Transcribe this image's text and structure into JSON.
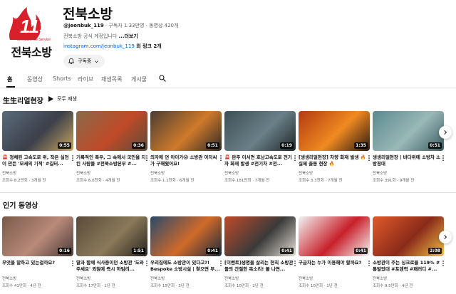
{
  "channel": {
    "name": "전북소방",
    "logo_text": "전북소방",
    "logo_badge": "119",
    "logo_sub": "Jeonbuk Fire Service",
    "handle": "@jeonbuk_119",
    "stats": " · 구독자 1.33만명 · 동영상 420개",
    "description": "전북소방 공식 계정입니다 ",
    "description_more": "...더보기",
    "link": "instagram.com/jeonbuk_119",
    "link_more": " 외 링크 2개",
    "subscribe_label": "구독중"
  },
  "tabs": [
    {
      "label": "홈"
    },
    {
      "label": "동영상"
    },
    {
      "label": "Shorts"
    },
    {
      "label": "라이브"
    },
    {
      "label": "재생목록"
    },
    {
      "label": "게시물"
    }
  ],
  "sections": [
    {
      "title": "生生리얼현장",
      "play_all": "모두 재생",
      "videos": [
        {
          "title": "🚨 정체된 고속도로 위, 작은 실천이 만든 '모세의 기적' #길터...",
          "channel": "전북소방",
          "meta": "조회수 8.2만회 · 3개월 전",
          "duration": "0:55",
          "colors": [
            "#5a6b7a",
            "#3b3f4a",
            "#c8a560"
          ]
        },
        {
          "title": "기록적인 폭우, 그 속에서 국민을 지킨 사람들 #전북소방본부 #...",
          "channel": "전북소방",
          "meta": "조회수 6.6천회 · 4개월 전",
          "duration": "0:36",
          "colors": [
            "#8a6a4a",
            "#c04a28",
            "#5b4c3a"
          ]
        },
        {
          "title": "의자에 연 아이가😱 소방관 아저씨가 구해줬어요!",
          "channel": "전북소방",
          "meta": "조회수 1.1천회 · 6개월 전",
          "duration": "0:51",
          "colors": [
            "#4a3d33",
            "#d07a2a",
            "#2e2a26"
          ]
        },
        {
          "title": "🚨 완주 이서면 호남고속도로 전기차 화재 발생 #전기차 #전...",
          "channel": "전북소방",
          "meta": "조회수 181만회 · 7개월 전",
          "duration": "0:19",
          "colors": [
            "#3d4f55",
            "#6a8088",
            "#1e2628"
          ]
        },
        {
          "title": "[생생리얼현장] 차량 화재 발생 🔥 실제 출동 현장 🔥",
          "channel": "전북소방",
          "meta": "조회수 3.3천회 · 7개월 전",
          "duration": "1:35",
          "colors": [
            "#b23a12",
            "#f08a20",
            "#2a1a12"
          ]
        },
        {
          "title": "생생리얼현장 | 바다위에 소방차 소방정대",
          "channel": "전북소방",
          "meta": "조회수 391회 · 9개월 전",
          "duration": "0:51",
          "colors": [
            "#5a8a8e",
            "#9ab8b8",
            "#3a5a5e"
          ]
        }
      ]
    },
    {
      "title": "인기 동영상",
      "videos": [
        {
          "title": "무엇을 말하고 있는걸까요?",
          "channel": "전북소방",
          "meta": "조회수 41만회 · 4년 전",
          "duration": "0:16",
          "colors": [
            "#7a5a4a",
            "#b88a7a",
            "#4a3a36"
          ]
        },
        {
          "title": "딸과 함께 식사중이던 소방관 '도와주세요' 외침에 즉시 하임리...",
          "channel": "전북소방",
          "meta": "조회수 17만회 · 1년 전",
          "duration": "1:51",
          "colors": [
            "#5a4a3a",
            "#8a7a5a",
            "#2a2420"
          ]
        },
        {
          "title": "우리집에도 소방관이 있다고?! Bespoke 소방시설 | 찾으면 부...",
          "channel": "전북소방",
          "meta": "조회수 15만회 · 3년 전",
          "duration": "0:41",
          "colors": [
            "#2a4a6a",
            "#d06a2a",
            "#1a2a3a"
          ]
        },
        {
          "title": "[이벤트]생명을 살리는 현직 소방관들의 간절한 목소리! 볼 나면...",
          "channel": "전북소방",
          "meta": "조회수 10만회 · 2년 전",
          "duration": "0:41",
          "colors": [
            "#c04a2a",
            "#3a3a3a",
            "#e6e0d6"
          ]
        },
        {
          "title": "구급차는 누가 이용해야 할까요?",
          "channel": "전북소방",
          "meta": "조회수 10만회 · 1년 전",
          "duration": "0:41",
          "colors": [
            "#f2f2f2",
            "#c8202a",
            "#f6f6f6"
          ]
        },
        {
          "title": "소방관이 주는 싱크로율 119% #통발았대 #포덴력 #패러디 #...",
          "channel": "전북소방",
          "meta": "조회수 9.5만회 · 4년 전",
          "duration": "2:08",
          "colors": [
            "#e05a2a",
            "#8a2a1a",
            "#f0c040"
          ]
        }
      ]
    }
  ]
}
